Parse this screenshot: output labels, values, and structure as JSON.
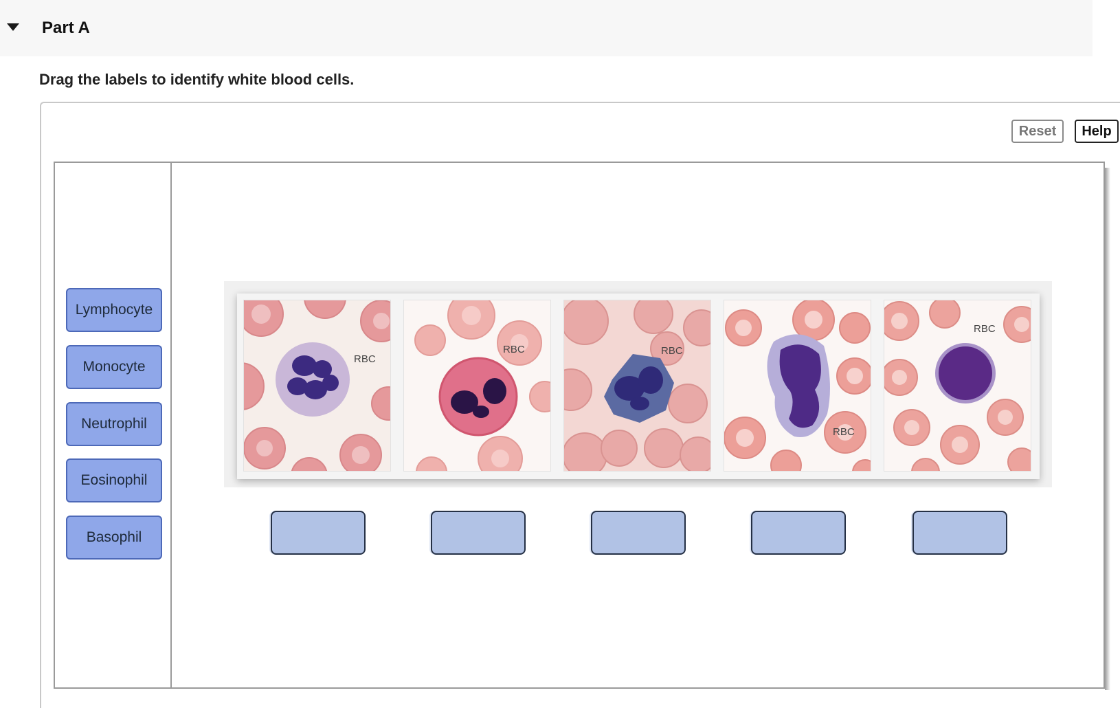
{
  "part": {
    "title": "Part A"
  },
  "instructions": "Drag the labels to identify white blood cells.",
  "toolbar": {
    "reset_label": "Reset",
    "help_label": "Help"
  },
  "labels": [
    "Lymphocyte",
    "Monocyte",
    "Neutrophil",
    "Eosinophil",
    "Basophil"
  ],
  "rbc_tag": "RBC",
  "colors": {
    "label_fill": "#8fa7e9",
    "drop_target_fill": "#b1c2e5",
    "rbc": "#e8a3a5",
    "nucleus": "#3d2466"
  }
}
